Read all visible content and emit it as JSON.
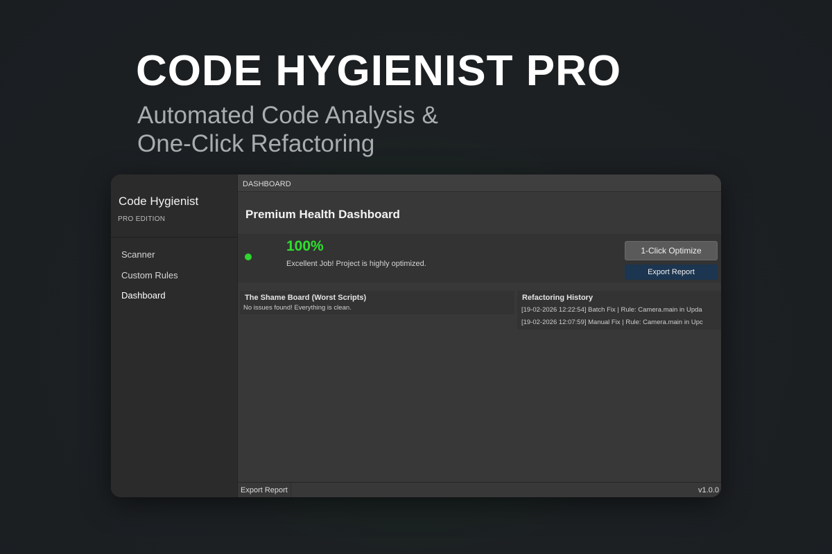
{
  "hero": {
    "title": "CODE HYGIENIST PRO",
    "subtitle_line1": "Automated Code Analysis &",
    "subtitle_line2": "One-Click Refactoring"
  },
  "sidebar": {
    "app_name": "Code Hygienist",
    "edition": "PRO EDITION",
    "items": [
      {
        "label": "Scanner"
      },
      {
        "label": "Custom Rules"
      },
      {
        "label": "Dashboard",
        "active": true
      }
    ]
  },
  "main": {
    "topbar_label": "DASHBOARD",
    "page_title": "Premium Health Dashboard",
    "health": {
      "score": "100%",
      "message": "Excellent Job! Project is highly optimized.",
      "status_color": "#2fd62f"
    },
    "buttons": {
      "optimize_label": "1-Click Optimize",
      "export_label": "Export Report"
    },
    "shame_board": {
      "title": "The Shame Board (Worst Scripts)",
      "message": "No issues found! Everything is clean."
    },
    "history": {
      "title": "Refactoring History",
      "entries": [
        "[19-02-2026 12:22:54] Batch Fix | Rule: Camera.main in Upda",
        "[19-02-2026 12:07:59] Manual Fix | Rule: Camera.main in Upc"
      ]
    }
  },
  "footer": {
    "export_label": "Export Report",
    "version": "v1.0.0"
  },
  "colors": {
    "accent_green": "#2fe02f",
    "export_button": "#1c3550"
  }
}
